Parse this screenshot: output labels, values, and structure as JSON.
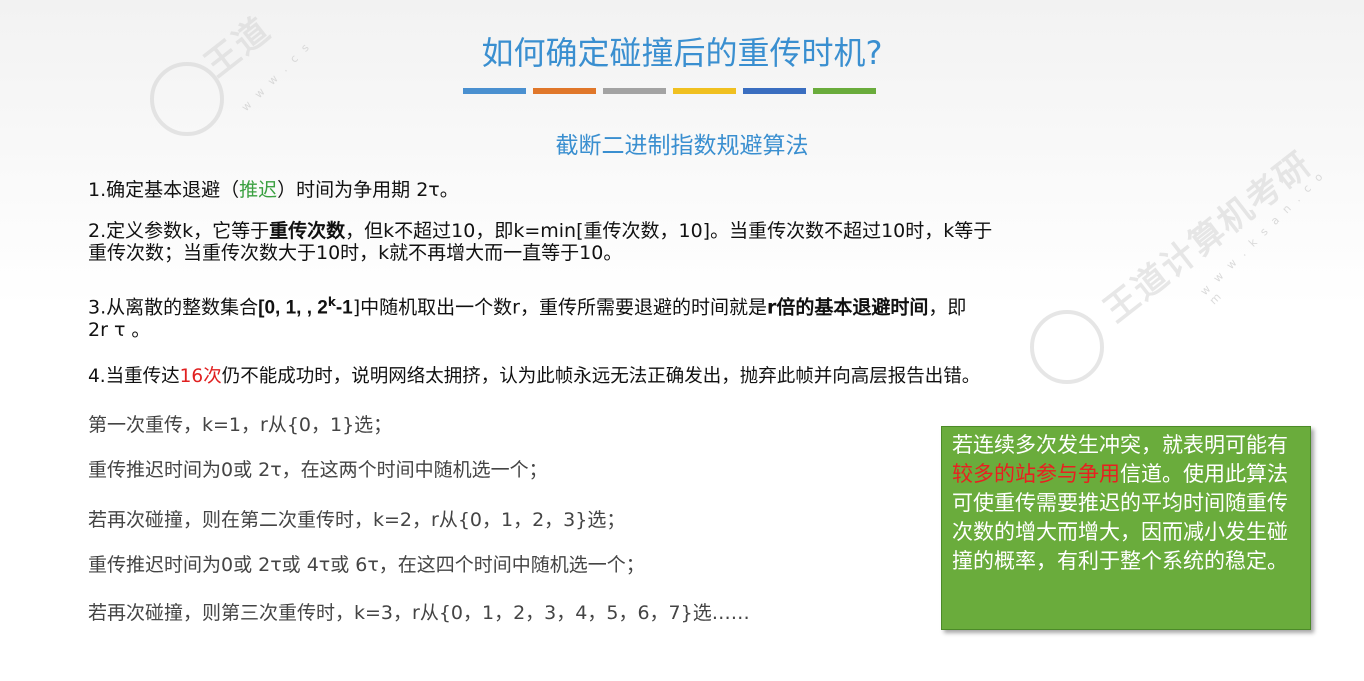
{
  "title": "如何确定碰撞后的重传时机?",
  "title_bar_colors": [
    "#4a90d0",
    "#e0772a",
    "#a3a3a3",
    "#f0c020",
    "#3a6ec0",
    "#6aac3c"
  ],
  "subtitle": "截断二进制指数规避算法",
  "rules": {
    "r1": {
      "a": "1.确定基本退避（",
      "green": "推迟",
      "b": "）时间为争用期 2τ。"
    },
    "r2": {
      "a": "2.定义参数k，它等于",
      "bold": "重传次数",
      "b": "，但k不超过10，即k=min[重传次数，10]。当重传次数不超过10时，k等于",
      "c": "重传次数；当重传次数大于10时，k就不再增大而一直等于10。"
    },
    "r3": {
      "a": "3.从离散的整数集合",
      "set_bold_open": "[0, 1, , 2",
      "sup": "k",
      "set_bold_close": "-1",
      "b": "]中随机取出一个数r，重传所需要退避的时间就是",
      "bold": "r倍的基本退避时间",
      "c": "，即",
      "d": "2r τ 。"
    },
    "r4": {
      "a": "4.当重传达",
      "red": "16次",
      "b": "仍不能成功时，说明网络太拥挤，认为此帧永远无法正确发出，抛弃此帧并向高层报告出错。"
    }
  },
  "examples": [
    "第一次重传，k=1，r从{0，1}选；",
    "重传推迟时间为0或 2τ，在这两个时间中随机选一个；",
    "若再次碰撞，则在第二次重传时，k=2，r从{0，1，2，3}选；",
    "重传推迟时间为0或 2τ或 4τ或 6τ，在这四个时间中随机选一个；",
    "若再次碰撞，则第三次重传时，k=3，r从{0，1，2，3，4，5，6，7}选……"
  ],
  "callout": {
    "a": "若连续多次发生冲突，就表明可能有",
    "highlight": "较多的站参与争用",
    "b": "信道。使用此算法可使重传需要推迟的平均时间随重传次数的增大而增大，因而减小发生碰撞的概率，有利于整个系统的稳定。"
  }
}
